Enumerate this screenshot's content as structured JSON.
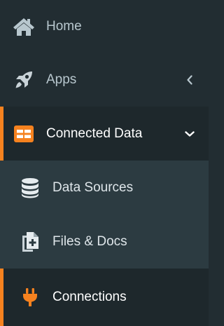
{
  "sidebar": {
    "items": [
      {
        "label": "Home",
        "icon": "home-icon"
      },
      {
        "label": "Apps",
        "icon": "rocket-icon",
        "indicator": "chevron-left-icon"
      },
      {
        "label": "Connected Data",
        "icon": "table-icon",
        "indicator": "chevron-down-icon",
        "active": true,
        "children": [
          {
            "label": "Data Sources",
            "icon": "database-icon"
          },
          {
            "label": "Files & Docs",
            "icon": "file-plus-icon"
          },
          {
            "label": "Connections",
            "icon": "plug-icon",
            "active": true
          }
        ]
      }
    ]
  },
  "colors": {
    "sidebar_bg": "#222d32",
    "submenu_bg": "#2c3b41",
    "active_bg": "#1e282c",
    "accent": "#f6821f",
    "text": "#b8c7ce",
    "text_active": "#ffffff"
  }
}
